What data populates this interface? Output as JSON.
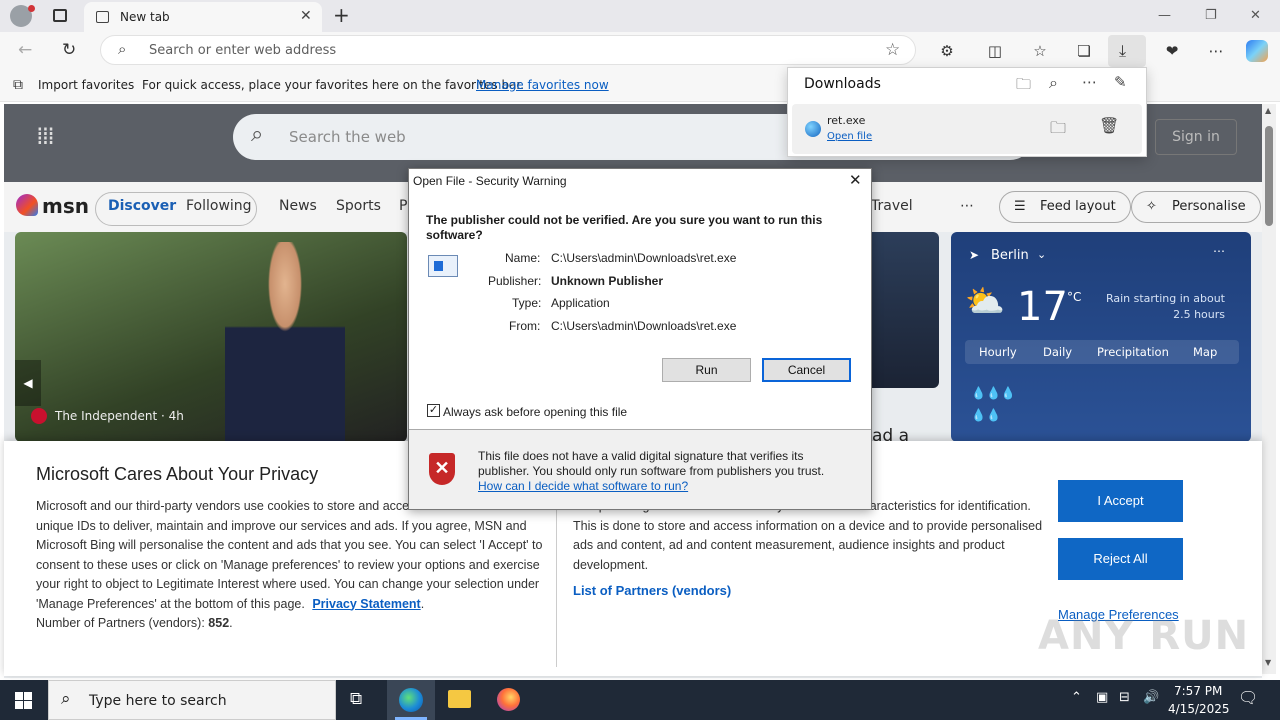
{
  "browser": {
    "tab_title": "New tab",
    "address_placeholder": "Search or enter web address"
  },
  "favbar": {
    "import_label": "Import favorites",
    "hint": "For quick access, place your favorites here on the favorites bar.",
    "manage_link": "Manage favorites now"
  },
  "msn": {
    "logo_text": "msn",
    "search_placeholder": "Search the web",
    "signin_label": "Sign in",
    "nav": [
      "Discover",
      "Following",
      "News",
      "Sports",
      "P",
      "Travel"
    ],
    "feed_layout": "Feed layout",
    "personalise": "Personalise",
    "hero_source": "The Independent · 4h",
    "hero2_text": "ad a",
    "weather": {
      "city": "Berlin",
      "temp": "17",
      "unit": "°C",
      "desc": "Rain starting in about 2.5 hours",
      "tabs": [
        "Hourly",
        "Daily",
        "Precipitation",
        "Map"
      ]
    }
  },
  "downloads": {
    "title": "Downloads",
    "file_name": "ret.exe",
    "open_link": "Open file"
  },
  "dialog": {
    "title": "Open File - Security Warning",
    "question": "The publisher could not be verified.  Are you sure you want to run this software?",
    "fields": [
      {
        "label": "Name:",
        "value": "C:\\Users\\admin\\Downloads\\ret.exe"
      },
      {
        "label": "Publisher:",
        "value": "Unknown Publisher"
      },
      {
        "label": "Type:",
        "value": "Application"
      },
      {
        "label": "From:",
        "value": "C:\\Users\\admin\\Downloads\\ret.exe"
      }
    ],
    "run_label": "Run",
    "cancel_label": "Cancel",
    "checkbox_label": "Always ask before opening this file",
    "warning_text": "This file does not have a valid digital signature that verifies its publisher.  You should only run software from publishers you trust.",
    "help_link": "How can I decide what software to run?"
  },
  "privacy": {
    "heading": "Microsoft Cares About Your Privacy",
    "body": "Microsoft and our third-party vendors use cookies to store and access information such as unique IDs to deliver, maintain and improve our services and ads. If you agree, MSN and Microsoft Bing will personalise the content and ads that you see. You can select 'I Accept' to consent to these uses or click on 'Manage preferences' to review your options and exercise your right to object to Legitimate Interest where used.  You can change your selection under 'Manage Preferences' at the bottom of this page.",
    "privacy_link": "Privacy Statement",
    "partners_label": "Number of Partners (vendors):",
    "partners_count": "852",
    "body2": "Use precise geolocation data. Actively scan device characteristics for identification. This is done to store and access information on a device and to provide personalised ads and content, ad and content measurement, audience insights and product development.",
    "partners_link": "List of Partners (vendors)",
    "accept": "I Accept",
    "reject": "Reject All",
    "manage": "Manage Preferences"
  },
  "taskbar": {
    "search_placeholder": "Type here to search",
    "time": "7:57 PM",
    "date": "4/15/2025"
  },
  "watermark": "ANY RUN"
}
